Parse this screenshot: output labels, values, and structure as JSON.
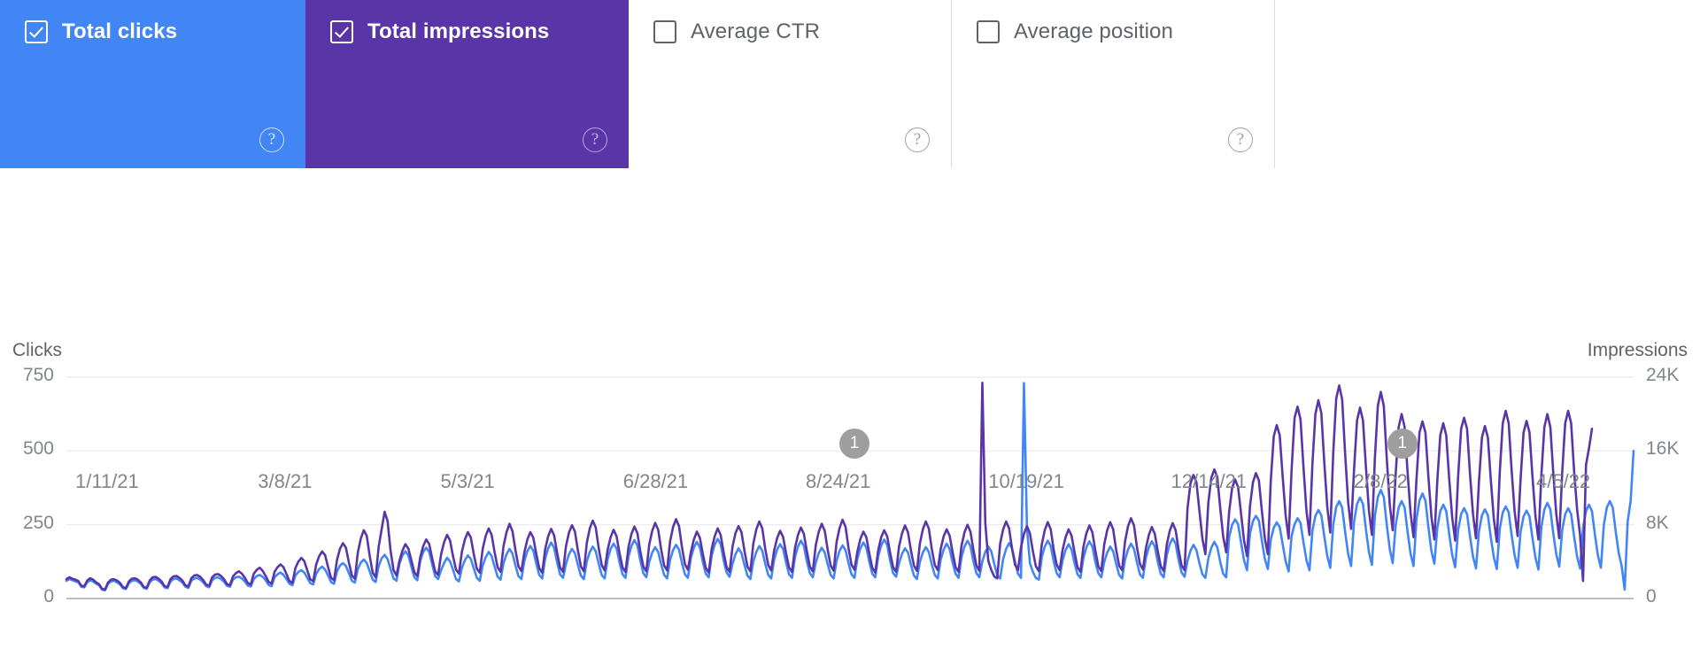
{
  "tabs": [
    {
      "label": "Total clicks",
      "checked": true,
      "state": "selected-blue",
      "help": "?"
    },
    {
      "label": "Total impressions",
      "checked": true,
      "state": "selected-purple",
      "help": "?"
    },
    {
      "label": "Average CTR",
      "checked": false,
      "state": "unselected",
      "help": "?"
    },
    {
      "label": "Average position",
      "checked": false,
      "state": "unselected",
      "help": "?"
    }
  ],
  "colors": {
    "clicks": "#4285f4",
    "impressions": "#5a35a8",
    "tab_selected_blue": "#4285f4",
    "tab_selected_purple": "#5a35a8",
    "grid": "#ededed",
    "axis": "#bdbdbd",
    "text_muted": "#80868b",
    "annotation_badge": "#9e9e9e"
  },
  "annotations": [
    {
      "label": "1",
      "x_date": "8/24/21"
    },
    {
      "label": "1",
      "x_date": "2/8/22"
    }
  ],
  "chart_data": {
    "type": "line",
    "title": "",
    "grid": true,
    "legend_position": "tabs-above",
    "ylabel": "Clicks",
    "y2label": "Impressions",
    "xlabel": "",
    "ylim": [
      0,
      750
    ],
    "y2lim": [
      0,
      24000
    ],
    "yticks": [
      0,
      250,
      500,
      750
    ],
    "ytick_labels": [
      "0",
      "250",
      "500",
      "750"
    ],
    "y2ticks": [
      0,
      8000,
      16000,
      24000
    ],
    "y2tick_labels": [
      "0",
      "8K",
      "16K",
      "24K"
    ],
    "xtick_labels": [
      "1/11/21",
      "3/8/21",
      "5/3/21",
      "6/28/21",
      "8/24/21",
      "10/19/21",
      "12/14/21",
      "2/8/22",
      "4/5/22"
    ],
    "x_start": "1/11/21",
    "x_end": "5/10/22",
    "n_points": 485,
    "series": [
      {
        "name": "Total clicks",
        "axis": "left",
        "color": "#4285f4",
        "values": [
          60,
          66,
          62,
          58,
          55,
          40,
          38,
          55,
          62,
          58,
          50,
          45,
          30,
          28,
          50,
          58,
          60,
          55,
          48,
          35,
          32,
          52,
          60,
          62,
          58,
          50,
          36,
          33,
          55,
          64,
          66,
          60,
          52,
          38,
          35,
          58,
          66,
          68,
          62,
          54,
          40,
          36,
          60,
          68,
          70,
          64,
          55,
          42,
          38,
          62,
          70,
          72,
          66,
          57,
          43,
          40,
          64,
          72,
          74,
          68,
          58,
          44,
          41,
          66,
          76,
          80,
          74,
          62,
          46,
          42,
          72,
          82,
          88,
          80,
          66,
          50,
          45,
          78,
          90,
          96,
          88,
          70,
          52,
          48,
          84,
          100,
          108,
          98,
          78,
          56,
          50,
          92,
          112,
          120,
          110,
          86,
          60,
          54,
          100,
          122,
          132,
          120,
          92,
          64,
          56,
          110,
          136,
          148,
          134,
          100,
          68,
          60,
          118,
          146,
          160,
          146,
          108,
          72,
          62,
          128,
          158,
          172,
          158,
          116,
          76,
          66,
          96,
          120,
          138,
          126,
          98,
          66,
          58,
          104,
          130,
          146,
          134,
          102,
          70,
          60,
          112,
          140,
          158,
          144,
          108,
          74,
          64,
          120,
          150,
          168,
          152,
          112,
          76,
          66,
          128,
          160,
          178,
          162,
          118,
          80,
          68,
          136,
          170,
          190,
          172,
          124,
          82,
          70,
          118,
          150,
          168,
          154,
          114,
          78,
          66,
          126,
          158,
          176,
          160,
          118,
          80,
          68,
          134,
          168,
          186,
          170,
          122,
          82,
          70,
          142,
          178,
          198,
          180,
          128,
          86,
          72,
          124,
          156,
          174,
          158,
          116,
          80,
          68,
          130,
          164,
          182,
          166,
          120,
          82,
          70,
          138,
          172,
          192,
          174,
          124,
          84,
          72,
          146,
          182,
          202,
          184,
          130,
          88,
          74,
          118,
          150,
          170,
          154,
          114,
          78,
          66,
          126,
          158,
          178,
          162,
          118,
          80,
          68,
          132,
          166,
          184,
          168,
          122,
          82,
          70,
          140,
          176,
          196,
          178,
          126,
          86,
          72,
          122,
          154,
          172,
          156,
          116,
          80,
          68,
          128,
          162,
          180,
          164,
          120,
          82,
          70,
          136,
          170,
          190,
          172,
          124,
          84,
          72,
          144,
          180,
          200,
          182,
          128,
          86,
          74,
          120,
          152,
          170,
          156,
          114,
          78,
          66,
          124,
          156,
          174,
          158,
          116,
          80,
          68,
          132,
          166,
          186,
          168,
          122,
          84,
          70,
          140,
          176,
          196,
          178,
          126,
          86,
          72,
          126,
          158,
          176,
          160,
          118,
          80,
          68,
          134,
          168,
          188,
          170,
          124,
          84,
          70,
          730,
          240,
          120,
          90,
          70,
          64,
          140,
          176,
          196,
          178,
          126,
          86,
          72,
          130,
          164,
          184,
          166,
          120,
          82,
          70,
          138,
          174,
          194,
          176,
          124,
          86,
          72,
          124,
          156,
          176,
          160,
          118,
          80,
          68,
          132,
          166,
          186,
          168,
          122,
          82,
          70,
          138,
          174,
          194,
          176,
          124,
          84,
          72,
          146,
          184,
          204,
          186,
          130,
          88,
          74,
          128,
          162,
          182,
          164,
          120,
          82,
          70,
          136,
          172,
          192,
          174,
          124,
          84,
          72,
          210,
          250,
          268,
          252,
          190,
          130,
          96,
          220,
          262,
          280,
          264,
          196,
          134,
          100,
          200,
          240,
          258,
          242,
          184,
          126,
          92,
          212,
          252,
          272,
          256,
          190,
          130,
          96,
          230,
          280,
          300,
          282,
          210,
          144,
          104,
          250,
          310,
          330,
          308,
          226,
          152,
          110,
          260,
          320,
          342,
          320,
          234,
          158,
          114,
          280,
          344,
          368,
          344,
          250,
          168,
          120,
          250,
          308,
          330,
          308,
          226,
          152,
          110,
          270,
          332,
          356,
          332,
          242,
          162,
          118,
          240,
          296,
          318,
          296,
          218,
          148,
          106,
          232,
          286,
          306,
          286,
          210,
          142,
          102,
          228,
          282,
          302,
          282,
          206,
          140,
          100,
          236,
          292,
          312,
          292,
          214,
          146,
          104,
          226,
          278,
          298,
          278,
          204,
          138,
          98,
          244,
          302,
          324,
          302,
          220,
          150,
          108,
          232,
          286,
          306,
          286,
          210,
          142,
          102,
          240,
          296,
          318,
          296,
          216,
          146,
          104,
          250,
          308,
          330,
          308,
          226,
          154,
          110,
          30,
          260,
          330,
          500
        ]
      },
      {
        "name": "Total impressions",
        "axis": "right",
        "color": "#5a35a8",
        "values": [
          2100,
          2300,
          2150,
          2050,
          1900,
          1400,
          1320,
          1950,
          2200,
          2050,
          1750,
          1550,
          1050,
          980,
          1750,
          2050,
          2100,
          1950,
          1700,
          1250,
          1120,
          1850,
          2150,
          2200,
          2050,
          1750,
          1260,
          1160,
          1950,
          2300,
          2350,
          2150,
          1850,
          1350,
          1240,
          2100,
          2400,
          2450,
          2250,
          1950,
          1450,
          1300,
          2200,
          2500,
          2550,
          2350,
          2000,
          1520,
          1380,
          2300,
          2600,
          2650,
          2450,
          2100,
          1560,
          1450,
          2400,
          2750,
          2950,
          2700,
          2250,
          1680,
          1520,
          2700,
          3100,
          3350,
          3000,
          2450,
          1800,
          1620,
          2900,
          3400,
          3700,
          3400,
          2650,
          1900,
          1700,
          3300,
          4000,
          4400,
          4050,
          3050,
          2080,
          1880,
          3700,
          4600,
          5100,
          4700,
          3400,
          2250,
          1980,
          4200,
          5400,
          6000,
          5500,
          3900,
          2500,
          2150,
          5000,
          6500,
          7400,
          6800,
          4600,
          2800,
          2300,
          5600,
          7500,
          9400,
          8400,
          5200,
          3100,
          2500,
          4100,
          5200,
          5900,
          5400,
          4150,
          2850,
          2420,
          4500,
          5700,
          6400,
          5900,
          4350,
          2950,
          2550,
          4800,
          6100,
          6900,
          6300,
          4600,
          3150,
          2700,
          5100,
          6400,
          7200,
          6600,
          4800,
          3250,
          2800,
          5400,
          6800,
          7600,
          6900,
          5000,
          3400,
          2900,
          5700,
          7200,
          8100,
          7300,
          5250,
          3500,
          2980,
          5000,
          6400,
          7200,
          6600,
          4850,
          3300,
          2800,
          5350,
          6750,
          7550,
          6850,
          4980,
          3400,
          2880,
          5700,
          7150,
          7950,
          7250,
          5200,
          3500,
          2950,
          6050,
          7600,
          8450,
          7700,
          5450,
          3650,
          3050,
          5280,
          6650,
          7450,
          6750,
          4920,
          3380,
          2880,
          5550,
          7000,
          7800,
          7100,
          5100,
          3480,
          2950,
          5880,
          7350,
          8200,
          7450,
          5300,
          3580,
          3050,
          6200,
          7750,
          8600,
          7850,
          5550,
          3720,
          3120,
          5050,
          6400,
          7250,
          6600,
          4850,
          3320,
          2820,
          5400,
          6750,
          7600,
          6900,
          5020,
          3400,
          2900,
          5650,
          7100,
          7850,
          7200,
          5200,
          3480,
          2950,
          5980,
          7500,
          8350,
          7600,
          5380,
          3650,
          3050,
          5220,
          6550,
          7350,
          6680,
          4900,
          3380,
          2880,
          5480,
          6900,
          7700,
          7000,
          5100,
          3480,
          2950,
          5820,
          7250,
          8100,
          7350,
          5280,
          3580,
          3020,
          6150,
          7650,
          8550,
          7780,
          5480,
          3680,
          3120,
          5120,
          6480,
          7250,
          6650,
          4870,
          3320,
          2820,
          5280,
          6650,
          7400,
          6750,
          4950,
          3400,
          2900,
          5650,
          7080,
          7920,
          7180,
          5200,
          3570,
          3000,
          5980,
          7500,
          8350,
          7600,
          5380,
          3650,
          3080,
          5380,
          6750,
          7500,
          6820,
          5020,
          3400,
          2900,
          5720,
          7180,
          8000,
          7250,
          5280,
          3580,
          3000,
          23400,
          8200,
          4100,
          3100,
          2400,
          2180,
          5980,
          7500,
          8350,
          7600,
          5380,
          3670,
          3080,
          5550,
          7000,
          7850,
          7080,
          5120,
          3500,
          2980,
          5880,
          7420,
          8280,
          7500,
          5280,
          3670,
          3080,
          5280,
          6650,
          7500,
          6820,
          5020,
          3400,
          2900,
          5620,
          7080,
          7920,
          7180,
          5200,
          3500,
          2980,
          5880,
          7420,
          8280,
          7500,
          5280,
          3580,
          3080,
          6220,
          7850,
          8700,
          7920,
          5550,
          3750,
          3150,
          5450,
          6900,
          7750,
          7000,
          5120,
          3500,
          2980,
          5800,
          7320,
          8180,
          7420,
          5280,
          3580,
          3080,
          9800,
          12500,
          13400,
          12600,
          9500,
          6500,
          4800,
          10400,
          13100,
          14000,
          13200,
          9800,
          6700,
          5000,
          9400,
          12000,
          12900,
          12100,
          9200,
          6300,
          4600,
          10000,
          12600,
          13600,
          12800,
          9500,
          6500,
          4800,
          12800,
          17600,
          18800,
          17700,
          13200,
          9000,
          6500,
          14000,
          19600,
          20800,
          19400,
          14200,
          9500,
          6900,
          14600,
          20000,
          21500,
          20100,
          14700,
          9900,
          7150,
          15800,
          21700,
          23100,
          21600,
          15700,
          10500,
          7550,
          14000,
          19300,
          20700,
          19300,
          14200,
          9550,
          6900,
          15200,
          20900,
          22400,
          20900,
          15200,
          10200,
          7400,
          13500,
          18600,
          20000,
          18600,
          13700,
          9300,
          6650,
          13000,
          18000,
          19200,
          18000,
          13200,
          8900,
          6400,
          12800,
          17700,
          19000,
          17700,
          12950,
          8800,
          6280,
          13250,
          18400,
          19600,
          18400,
          13450,
          9170,
          6530,
          12650,
          17450,
          18700,
          17450,
          12800,
          8660,
          6150,
          13700,
          19000,
          20350,
          19000,
          13800,
          9420,
          6780,
          12950,
          18000,
          19250,
          18000,
          13200,
          8920,
          6400,
          13450,
          18600,
          20000,
          18600,
          13560,
          9170,
          6530,
          13700,
          19000,
          20350,
          19000,
          13800,
          9670,
          6900,
          1900,
          14500,
          16300,
          18400
        ]
      }
    ]
  }
}
